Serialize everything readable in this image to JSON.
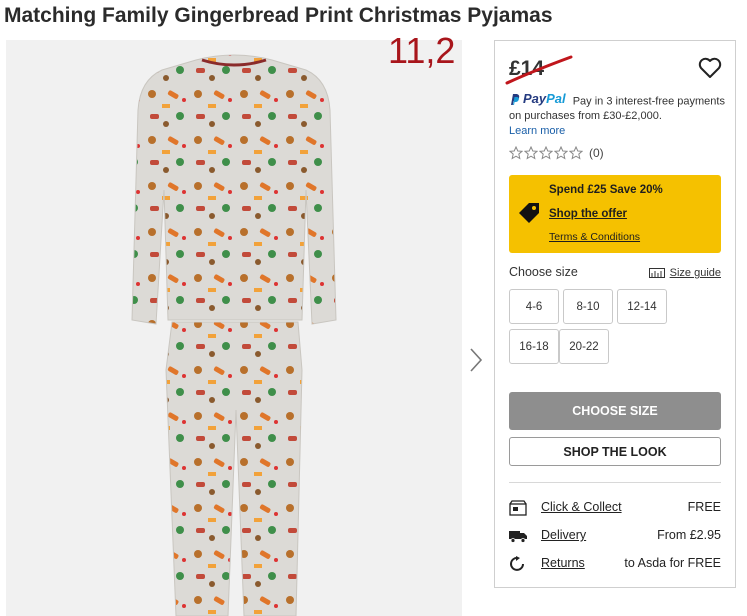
{
  "page": {
    "title": "Matching Family Gingerbread Print Christmas Pyjamas",
    "annotation": "11,2"
  },
  "product": {
    "price": "£14",
    "wishlist_icon": "heart-icon"
  },
  "paypal": {
    "brand_pay": "Pay",
    "brand_pal": "Pal",
    "text": "Pay in 3 interest-free payments on purchases from £30-£2,000.",
    "link": "Learn more"
  },
  "rating": {
    "stars": 0,
    "count": "(0)"
  },
  "offer": {
    "title": "Spend £25 Save 20%",
    "shop_link": "Shop the offer",
    "terms_link": "Terms & Conditions",
    "background": "#f5c100"
  },
  "sizes": {
    "heading": "Choose size",
    "guide_label": "Size guide",
    "options": [
      "4-6",
      "8-10",
      "12-14",
      "16-18",
      "20-22"
    ]
  },
  "actions": {
    "choose_size": "CHOOSE SIZE",
    "shop_look": "SHOP THE LOOK"
  },
  "delivery": [
    {
      "label": "Click & Collect",
      "value": "FREE",
      "icon": "store-icon"
    },
    {
      "label": "Delivery",
      "value": "From £2.95",
      "icon": "truck-icon"
    },
    {
      "label": "Returns",
      "value": "to Asda for FREE",
      "icon": "returns-icon"
    }
  ],
  "colors": {
    "accent_yellow": "#f5c100",
    "strike_red": "#c0161c",
    "button_grey": "#8e8e8e"
  }
}
